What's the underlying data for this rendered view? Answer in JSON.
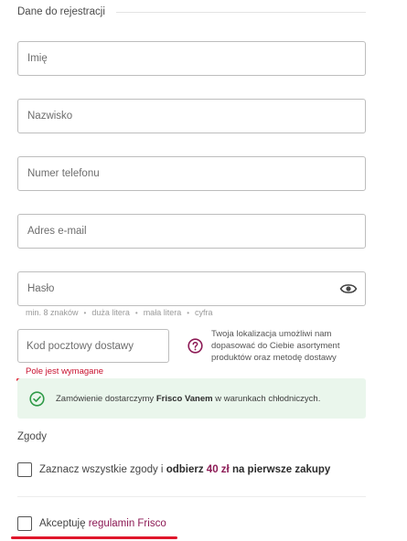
{
  "section": {
    "title": "Dane do rejestracji"
  },
  "fields": {
    "first_name_placeholder": "Imię",
    "last_name_placeholder": "Nazwisko",
    "phone_placeholder": "Numer telefonu",
    "email_placeholder": "Adres e-mail",
    "password_placeholder": "Hasło",
    "postcode_placeholder": "Kod pocztowy dostawy"
  },
  "password_hints": [
    "min. 8 znaków",
    "duża litera",
    "mała litera",
    "cyfra"
  ],
  "location_info": "Twoja lokalizacja umożliwi nam dopasować do Ciebie asortyment produktów oraz metodę dostawy",
  "postcode_error": "Pole jest wymagane",
  "delivery_notice": {
    "before": "Zamówienie dostarczymy",
    "bold": "Frisco Vanem",
    "after": "w warunkach chłodniczych."
  },
  "consents": {
    "title": "Zgody",
    "select_all": {
      "before": "Zaznacz wszystkie zgody i",
      "bold_1": "odbierz",
      "amount": "40 zł",
      "bold_2": "na pierwsze zakupy"
    },
    "terms": {
      "before": "Akceptuję",
      "link": "regulamin Frisco"
    }
  },
  "colors": {
    "accent": "#8c1a55",
    "error": "#c8102e",
    "success": "#2e9a47",
    "notice_bg": "#eaf6ec"
  },
  "icons": {
    "password_toggle": "eye-icon",
    "location_help": "question-circle-icon",
    "notice": "check-circle-icon"
  }
}
